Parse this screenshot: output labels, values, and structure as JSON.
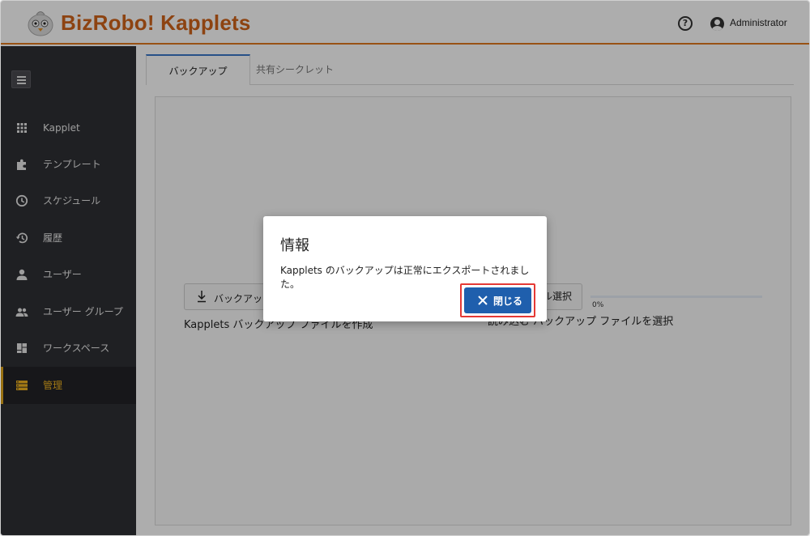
{
  "app": {
    "brand": "BizRobo! Kapplets",
    "help_glyph": "?",
    "user_name": "Administrator"
  },
  "sidebar": {
    "items": [
      {
        "label": "Kapplet",
        "icon": "grid-icon"
      },
      {
        "label": "テンプレート",
        "icon": "puzzle-icon"
      },
      {
        "label": "スケジュール",
        "icon": "clock-icon"
      },
      {
        "label": "履歴",
        "icon": "history-icon"
      },
      {
        "label": "ユーザー",
        "icon": "user-icon"
      },
      {
        "label": "ユーザー グループ",
        "icon": "users-icon"
      },
      {
        "label": "ワークスペース",
        "icon": "dashboard-icon"
      },
      {
        "label": "管理",
        "icon": "storage-icon",
        "active": true
      }
    ]
  },
  "tabs": [
    {
      "label": "バックアップ",
      "active": true
    },
    {
      "label": "共有シークレット",
      "active": false
    }
  ],
  "backup": {
    "button_label": "バックアップ",
    "description": "Kapplets バックアップ ファイルを作成",
    "select_button_label": "ル選択",
    "select_description": "読み込む バックアップ ファイルを選択",
    "progress_value": 0,
    "progress_label": "0%"
  },
  "dialog": {
    "title": "情報",
    "message": "Kapplets のバックアップは正常にエクスポートされました。",
    "close_label": "閉じる"
  },
  "colors": {
    "brand": "#d0631a",
    "accent": "#1f5fad",
    "active_nav": "#f0b320",
    "highlight": "#e53935"
  }
}
